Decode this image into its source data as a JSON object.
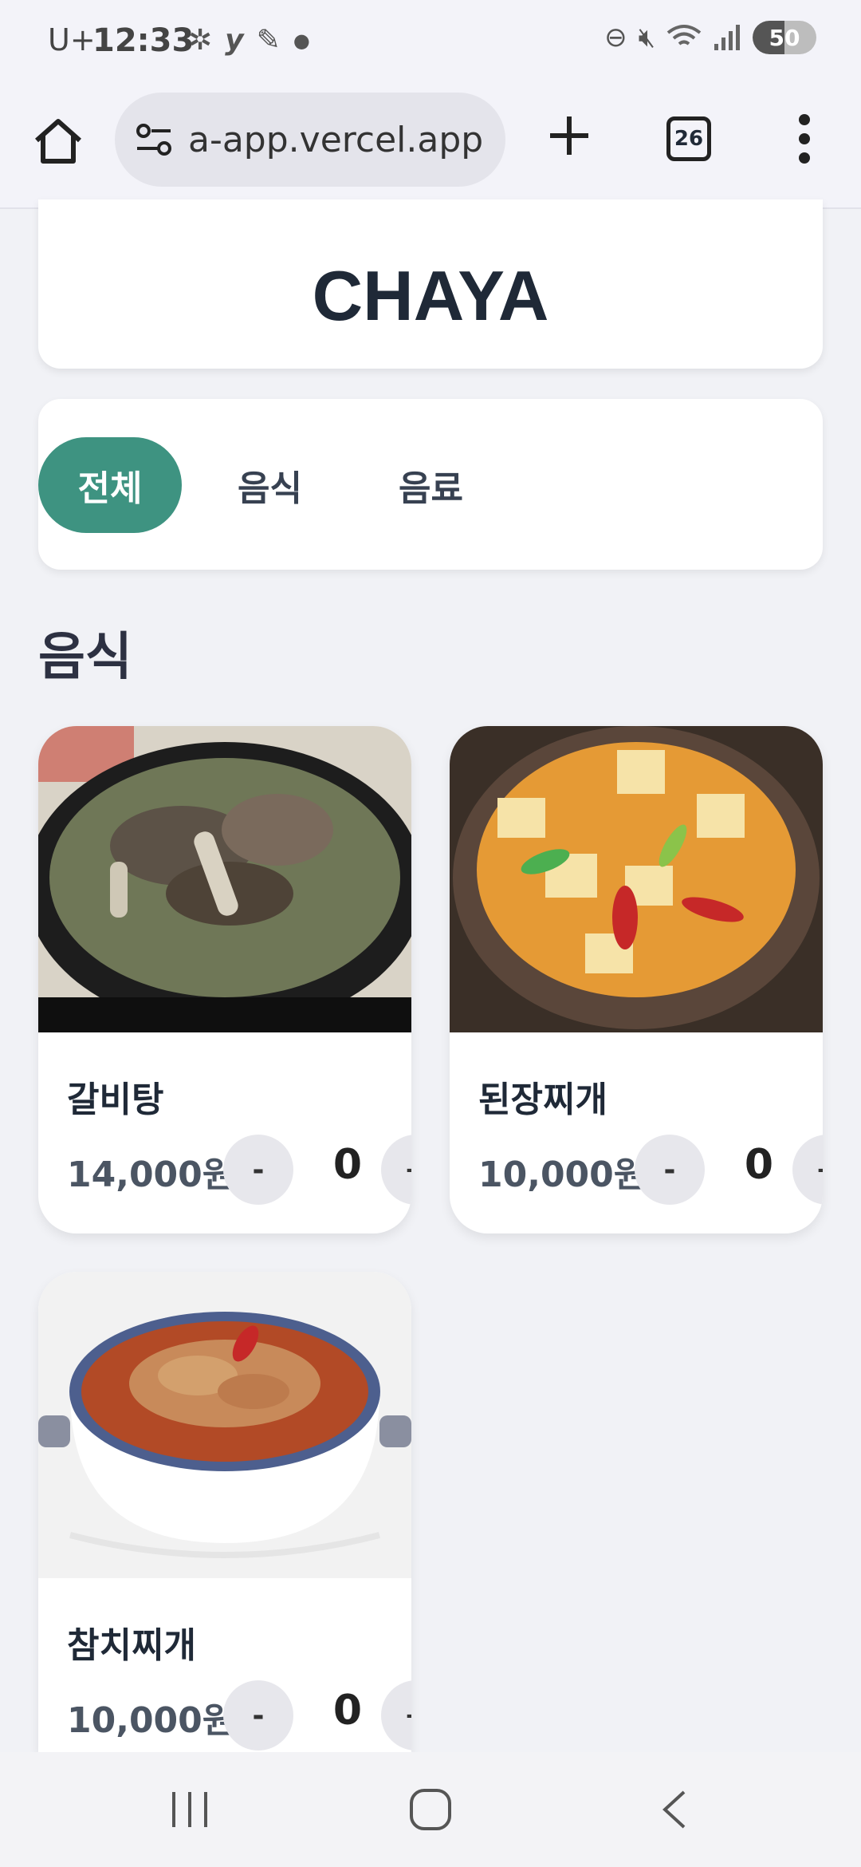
{
  "status_bar": {
    "carrier": "U+",
    "time": "12:33",
    "notif_icons": [
      "ai-sparkle-icon",
      "yahoo-icon",
      "feather-icon"
    ],
    "battery": "50"
  },
  "browser": {
    "url": "a-app.vercel.app",
    "tab_count": "26"
  },
  "header": {
    "brand": "CHAYA"
  },
  "categories": [
    {
      "label": "전체",
      "active": true
    },
    {
      "label": "음식",
      "active": false
    },
    {
      "label": "음료",
      "active": false
    }
  ],
  "section": {
    "title": "음식"
  },
  "items": [
    {
      "name": "갈비탕",
      "price": "14,000원",
      "qty": "0",
      "minus": "-",
      "plus": "+"
    },
    {
      "name": "된장찌개",
      "price": "10,000원",
      "qty": "0",
      "minus": "-",
      "plus": "+"
    },
    {
      "name": "참치찌개",
      "price": "10,000원",
      "qty": "0",
      "minus": "-",
      "plus": "+"
    }
  ],
  "colors": {
    "accent": "#3e9381",
    "background": "#f1f2f6"
  }
}
